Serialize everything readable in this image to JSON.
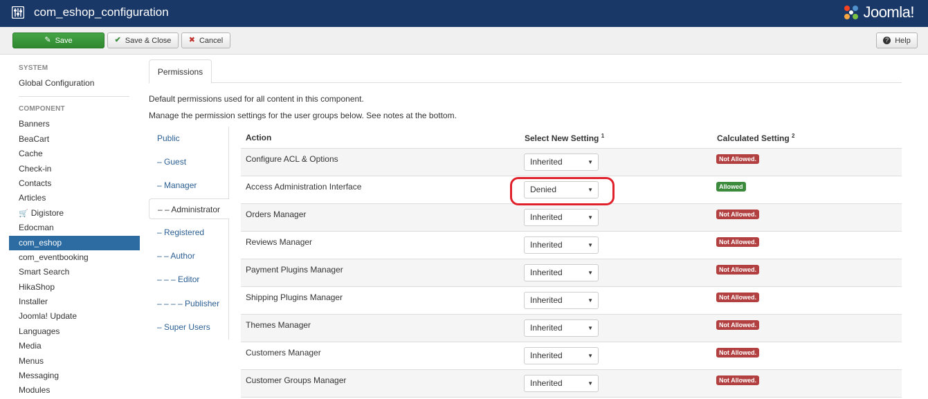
{
  "header": {
    "title": "com_eshop_configuration",
    "logo_text": "Joomla!",
    "colors": {
      "bar": "#1a3867"
    }
  },
  "toolbar": {
    "save_label": "Save",
    "save_close_label": "Save & Close",
    "cancel_label": "Cancel",
    "help_label": "Help"
  },
  "sidebar": {
    "system_heading": "SYSTEM",
    "system_items": [
      "Global Configuration"
    ],
    "component_heading": "COMPONENT",
    "component_items": [
      "Banners",
      "BeaCart",
      "Cache",
      "Check-in",
      "Contacts",
      "Articles",
      "Digistore",
      "Edocman",
      "com_eshop",
      "com_eventbooking",
      "Smart Search",
      "HikaShop",
      "Installer",
      "Joomla! Update",
      "Languages",
      "Media",
      "Menus",
      "Messaging",
      "Modules"
    ],
    "active_item": "com_eshop"
  },
  "main": {
    "tab_label": "Permissions",
    "desc_default": "Default permissions used for all content in this component.",
    "desc_manage": "Manage the permission settings for the user groups below. See notes at the bottom.",
    "groups": [
      "Public",
      "– Guest",
      "– Manager",
      "– – Administrator",
      "– Registered",
      "– – Author",
      "– – – Editor",
      "– – – – Publisher",
      "– Super Users"
    ],
    "active_group": "– – Administrator",
    "table": {
      "col_action": "Action",
      "col_select": "Select New Setting",
      "col_select_note": "1",
      "col_calc": "Calculated Setting",
      "col_calc_note": "2",
      "rows": [
        {
          "action": "Configure ACL & Options",
          "setting": "Inherited",
          "calculated": "Not Allowed."
        },
        {
          "action": "Access Administration Interface",
          "setting": "Denied",
          "calculated": "Allowed"
        },
        {
          "action": "Orders Manager",
          "setting": "Inherited",
          "calculated": "Not Allowed."
        },
        {
          "action": "Reviews Manager",
          "setting": "Inherited",
          "calculated": "Not Allowed."
        },
        {
          "action": "Payment Plugins Manager",
          "setting": "Inherited",
          "calculated": "Not Allowed."
        },
        {
          "action": "Shipping Plugins Manager",
          "setting": "Inherited",
          "calculated": "Not Allowed."
        },
        {
          "action": "Themes Manager",
          "setting": "Inherited",
          "calculated": "Not Allowed."
        },
        {
          "action": "Customers Manager",
          "setting": "Inherited",
          "calculated": "Not Allowed."
        },
        {
          "action": "Customer Groups Manager",
          "setting": "Inherited",
          "calculated": "Not Allowed."
        }
      ]
    }
  }
}
